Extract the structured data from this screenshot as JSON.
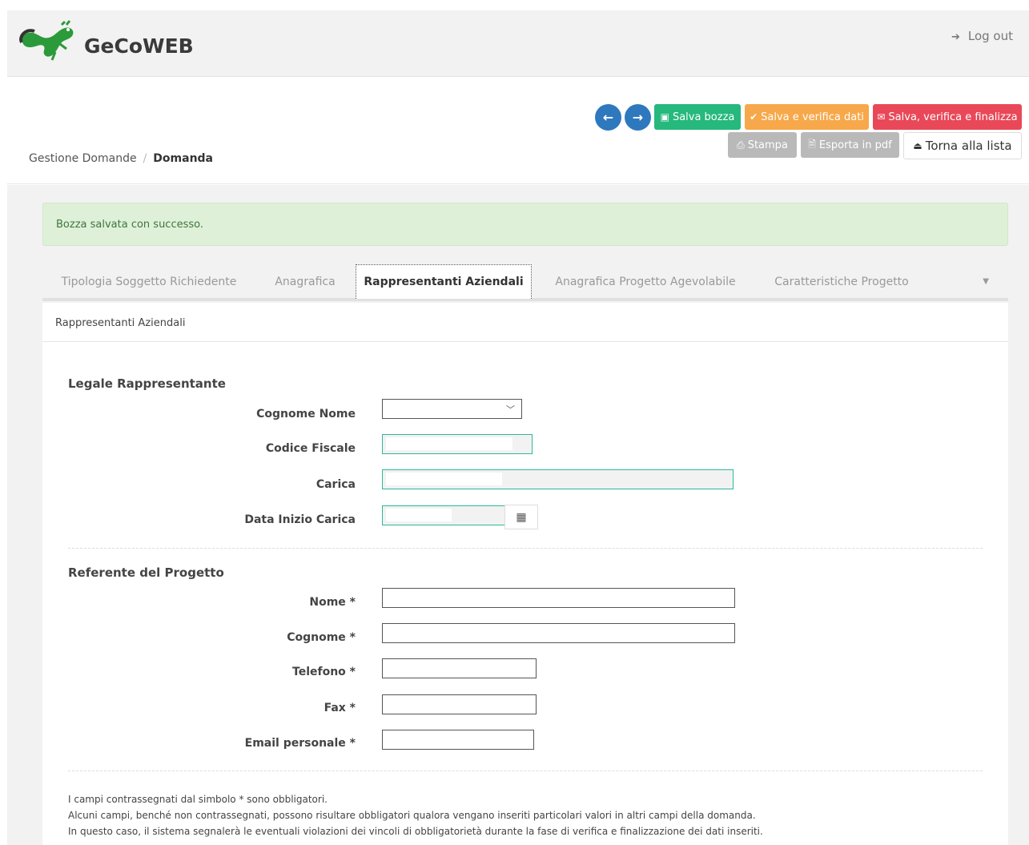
{
  "header": {
    "app_name": "GeCoWEB",
    "logout_label": "Log out",
    "logout_icon": "sign-out-icon"
  },
  "toolbar": {
    "prev_icon": "arrow-left-icon",
    "next_icon": "arrow-right-icon",
    "save_draft_label": "Salva bozza",
    "save_verify_label": "Salva e verifica dati",
    "save_finalize_label": "Salva, verifica e finalizza",
    "print_label": "Stampa",
    "export_pdf_label": "Esporta in pdf",
    "back_to_list_label": "Torna alla lista"
  },
  "breadcrumb": {
    "parent": "Gestione Domande",
    "separator": "/",
    "current": "Domanda"
  },
  "alert": {
    "message": "Bozza salvata con successo."
  },
  "tabs": [
    {
      "label": "Tipologia Soggetto Richiedente"
    },
    {
      "label": "Anagrafica"
    },
    {
      "label": "Rappresentanti Aziendali"
    },
    {
      "label": "Anagrafica Progetto Agevolabile"
    },
    {
      "label": "Caratteristiche Progetto"
    }
  ],
  "active_tab": "Rappresentanti Aziendali",
  "panel": {
    "title": "Rappresentanti Aziendali"
  },
  "legale": {
    "title": "Legale Rappresentante",
    "cognome_nome_label": "Cognome Nome",
    "codice_fiscale_label": "Codice Fiscale",
    "carica_label": "Carica",
    "data_inizio_label": "Data Inizio Carica"
  },
  "referente": {
    "title": "Referente del Progetto",
    "nome_label": "Nome *",
    "cognome_label": "Cognome *",
    "telefono_label": "Telefono *",
    "fax_label": "Fax *",
    "email_label": "Email personale *"
  },
  "footnote": {
    "line1": "I campi contrassegnati dal simbolo * sono obbligatori.",
    "line2": "Alcuni campi, benché non contrassegnati, possono risultare obbligatori qualora vengano inseriti particolari valori in altri campi della domanda.",
    "line3": "In questo caso, il sistema segnalerà le eventuali violazioni dei vincoli di obbligatorietà durante la fase di verifica e finalizzazione dei dati inseriti."
  },
  "colors": {
    "primary": "#2e78bd",
    "success": "#26b87d",
    "warning": "#f7a84a",
    "danger": "#e94858",
    "muted": "#b9b9b9",
    "filled_border": "#2eb89a"
  }
}
